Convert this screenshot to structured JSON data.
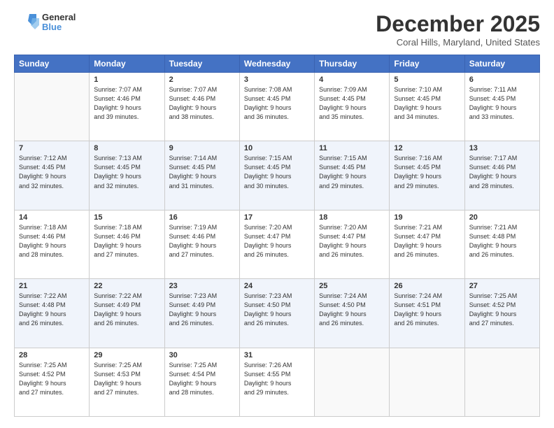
{
  "header": {
    "logo_general": "General",
    "logo_blue": "Blue",
    "title": "December 2025",
    "location": "Coral Hills, Maryland, United States"
  },
  "calendar": {
    "days_of_week": [
      "Sunday",
      "Monday",
      "Tuesday",
      "Wednesday",
      "Thursday",
      "Friday",
      "Saturday"
    ],
    "weeks": [
      [
        {
          "day": "",
          "info": ""
        },
        {
          "day": "1",
          "info": "Sunrise: 7:07 AM\nSunset: 4:46 PM\nDaylight: 9 hours\nand 39 minutes."
        },
        {
          "day": "2",
          "info": "Sunrise: 7:07 AM\nSunset: 4:46 PM\nDaylight: 9 hours\nand 38 minutes."
        },
        {
          "day": "3",
          "info": "Sunrise: 7:08 AM\nSunset: 4:45 PM\nDaylight: 9 hours\nand 36 minutes."
        },
        {
          "day": "4",
          "info": "Sunrise: 7:09 AM\nSunset: 4:45 PM\nDaylight: 9 hours\nand 35 minutes."
        },
        {
          "day": "5",
          "info": "Sunrise: 7:10 AM\nSunset: 4:45 PM\nDaylight: 9 hours\nand 34 minutes."
        },
        {
          "day": "6",
          "info": "Sunrise: 7:11 AM\nSunset: 4:45 PM\nDaylight: 9 hours\nand 33 minutes."
        }
      ],
      [
        {
          "day": "7",
          "info": "Sunrise: 7:12 AM\nSunset: 4:45 PM\nDaylight: 9 hours\nand 32 minutes."
        },
        {
          "day": "8",
          "info": "Sunrise: 7:13 AM\nSunset: 4:45 PM\nDaylight: 9 hours\nand 32 minutes."
        },
        {
          "day": "9",
          "info": "Sunrise: 7:14 AM\nSunset: 4:45 PM\nDaylight: 9 hours\nand 31 minutes."
        },
        {
          "day": "10",
          "info": "Sunrise: 7:15 AM\nSunset: 4:45 PM\nDaylight: 9 hours\nand 30 minutes."
        },
        {
          "day": "11",
          "info": "Sunrise: 7:15 AM\nSunset: 4:45 PM\nDaylight: 9 hours\nand 29 minutes."
        },
        {
          "day": "12",
          "info": "Sunrise: 7:16 AM\nSunset: 4:45 PM\nDaylight: 9 hours\nand 29 minutes."
        },
        {
          "day": "13",
          "info": "Sunrise: 7:17 AM\nSunset: 4:46 PM\nDaylight: 9 hours\nand 28 minutes."
        }
      ],
      [
        {
          "day": "14",
          "info": "Sunrise: 7:18 AM\nSunset: 4:46 PM\nDaylight: 9 hours\nand 28 minutes."
        },
        {
          "day": "15",
          "info": "Sunrise: 7:18 AM\nSunset: 4:46 PM\nDaylight: 9 hours\nand 27 minutes."
        },
        {
          "day": "16",
          "info": "Sunrise: 7:19 AM\nSunset: 4:46 PM\nDaylight: 9 hours\nand 27 minutes."
        },
        {
          "day": "17",
          "info": "Sunrise: 7:20 AM\nSunset: 4:47 PM\nDaylight: 9 hours\nand 26 minutes."
        },
        {
          "day": "18",
          "info": "Sunrise: 7:20 AM\nSunset: 4:47 PM\nDaylight: 9 hours\nand 26 minutes."
        },
        {
          "day": "19",
          "info": "Sunrise: 7:21 AM\nSunset: 4:47 PM\nDaylight: 9 hours\nand 26 minutes."
        },
        {
          "day": "20",
          "info": "Sunrise: 7:21 AM\nSunset: 4:48 PM\nDaylight: 9 hours\nand 26 minutes."
        }
      ],
      [
        {
          "day": "21",
          "info": "Sunrise: 7:22 AM\nSunset: 4:48 PM\nDaylight: 9 hours\nand 26 minutes."
        },
        {
          "day": "22",
          "info": "Sunrise: 7:22 AM\nSunset: 4:49 PM\nDaylight: 9 hours\nand 26 minutes."
        },
        {
          "day": "23",
          "info": "Sunrise: 7:23 AM\nSunset: 4:49 PM\nDaylight: 9 hours\nand 26 minutes."
        },
        {
          "day": "24",
          "info": "Sunrise: 7:23 AM\nSunset: 4:50 PM\nDaylight: 9 hours\nand 26 minutes."
        },
        {
          "day": "25",
          "info": "Sunrise: 7:24 AM\nSunset: 4:50 PM\nDaylight: 9 hours\nand 26 minutes."
        },
        {
          "day": "26",
          "info": "Sunrise: 7:24 AM\nSunset: 4:51 PM\nDaylight: 9 hours\nand 26 minutes."
        },
        {
          "day": "27",
          "info": "Sunrise: 7:25 AM\nSunset: 4:52 PM\nDaylight: 9 hours\nand 27 minutes."
        }
      ],
      [
        {
          "day": "28",
          "info": "Sunrise: 7:25 AM\nSunset: 4:52 PM\nDaylight: 9 hours\nand 27 minutes."
        },
        {
          "day": "29",
          "info": "Sunrise: 7:25 AM\nSunset: 4:53 PM\nDaylight: 9 hours\nand 27 minutes."
        },
        {
          "day": "30",
          "info": "Sunrise: 7:25 AM\nSunset: 4:54 PM\nDaylight: 9 hours\nand 28 minutes."
        },
        {
          "day": "31",
          "info": "Sunrise: 7:26 AM\nSunset: 4:55 PM\nDaylight: 9 hours\nand 29 minutes."
        },
        {
          "day": "",
          "info": ""
        },
        {
          "day": "",
          "info": ""
        },
        {
          "day": "",
          "info": ""
        }
      ]
    ]
  }
}
